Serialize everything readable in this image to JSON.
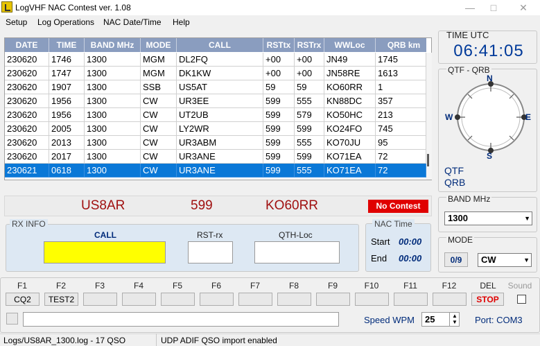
{
  "window": {
    "title": "LogVHF NAC Contest  ver. 1.08"
  },
  "menu": [
    "Setup",
    "Log Operations",
    "NAC Date/Time",
    "Help"
  ],
  "log": {
    "columns": [
      "DATE",
      "TIME",
      "BAND MHz",
      "MODE",
      "CALL",
      "RSTtx",
      "RSTrx",
      "WWLoc",
      "QRB km"
    ],
    "rows": [
      [
        "230620",
        "1746",
        "1300",
        "MGM",
        "DL2FQ",
        "+00",
        "+00",
        "JN49",
        "1745"
      ],
      [
        "230620",
        "1747",
        "1300",
        "MGM",
        "DK1KW",
        "+00",
        "+00",
        "JN58RE",
        "1613"
      ],
      [
        "230620",
        "1907",
        "1300",
        "SSB",
        "US5AT",
        "59",
        "59",
        "KO60RR",
        "1"
      ],
      [
        "230620",
        "1956",
        "1300",
        "CW",
        "UR3EE",
        "599",
        "555",
        "KN88DC",
        "357"
      ],
      [
        "230620",
        "1956",
        "1300",
        "CW",
        "UT2UB",
        "599",
        "579",
        "KO50HC",
        "213"
      ],
      [
        "230620",
        "2005",
        "1300",
        "CW",
        "LY2WR",
        "599",
        "599",
        "KO24FO",
        "745"
      ],
      [
        "230620",
        "2013",
        "1300",
        "CW",
        "UR3ABM",
        "599",
        "555",
        "KO70JU",
        "95"
      ],
      [
        "230620",
        "2017",
        "1300",
        "CW",
        "UR3ANE",
        "599",
        "599",
        "KO71EA",
        "72"
      ],
      [
        "230621",
        "0618",
        "1300",
        "CW",
        "UR3ANE",
        "599",
        "555",
        "KO71EA",
        "72"
      ]
    ],
    "selected_row": 8
  },
  "station": {
    "call": "US8AR",
    "rst": "599",
    "locator": "KO60RR",
    "contest_badge": "No Contest"
  },
  "rx_info": {
    "title": "RX INFO",
    "call_label": "CALL",
    "rst_label": "RST-rx",
    "qth_label": "QTH-Loc",
    "call_value": "",
    "rst_value": "",
    "qth_value": ""
  },
  "nac_time": {
    "title": "NAC Time",
    "start_label": "Start",
    "start_value": "00:00",
    "end_label": "End",
    "end_value": "00:00"
  },
  "time_utc": {
    "title": "TIME UTC",
    "value": "06:41:05"
  },
  "qtf": {
    "title": "QTF - QRB",
    "n": "N",
    "s": "S",
    "e": "E",
    "w": "W",
    "qtf_label": "QTF",
    "qrb_label": "QRB"
  },
  "band": {
    "title": "BAND MHz",
    "value": "1300"
  },
  "mode": {
    "title": "MODE",
    "counter": "0/9",
    "value": "CW"
  },
  "fkeys": {
    "labels": [
      "F1",
      "F2",
      "F3",
      "F4",
      "F5",
      "F6",
      "F7",
      "F8",
      "F9",
      "F10",
      "F11",
      "F12",
      "DEL",
      "Sound"
    ],
    "buttons": [
      "CQ2",
      "TEST2",
      "",
      "",
      "",
      "",
      "",
      "",
      "",
      "",
      "",
      "",
      "STOP"
    ]
  },
  "cw": {
    "speed_label": "Speed WPM",
    "speed_value": "25",
    "port": "Port: COM3"
  },
  "statusbar": {
    "left": "Logs/US8AR_1300.log - 17 QSO",
    "right": "UDP ADIF QSO import enabled"
  },
  "colors": {
    "header": "#8a9dbf",
    "selection": "#0a78d7",
    "accent_red": "#a01010",
    "time_blue": "#003a9a"
  }
}
